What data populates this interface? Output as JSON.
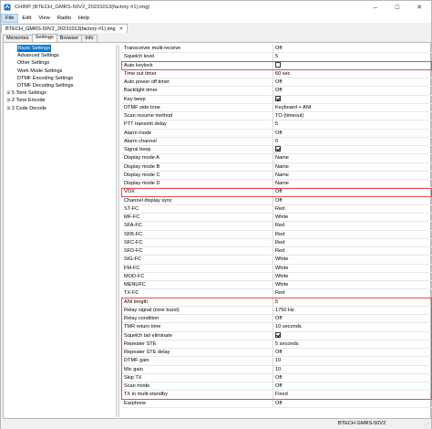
{
  "window": {
    "title": "CHIRP (BTECH_GMRS-50V2_20231013(factory #1).img)",
    "minimize": "–",
    "maximize": "☐",
    "close": "✕"
  },
  "menu": [
    {
      "label": "File"
    },
    {
      "label": "Edit"
    },
    {
      "label": "View"
    },
    {
      "label": "Radio"
    },
    {
      "label": "Help"
    }
  ],
  "doc_tab": {
    "label": "BTECH_GMRS-50V2_20231013(factory #1).img",
    "close": "✕"
  },
  "sub_tabs": [
    {
      "label": "Memories"
    },
    {
      "label": "Settings"
    },
    {
      "label": "Browser"
    },
    {
      "label": "Info"
    }
  ],
  "tree": [
    {
      "label": "Basic Settings",
      "selected": true,
      "expander": ""
    },
    {
      "label": "Advanced Settings",
      "expander": ""
    },
    {
      "label": "Other Settings",
      "expander": ""
    },
    {
      "label": "Work Mode Settings",
      "expander": ""
    },
    {
      "label": "DTMF Encoding Settings",
      "expander": ""
    },
    {
      "label": "DTMF Decoding Settings",
      "expander": ""
    },
    {
      "label": "5 Tone Settings",
      "expander": "⊞",
      "top": true
    },
    {
      "label": "2 Tone Encode",
      "expander": "⊞",
      "top": true
    },
    {
      "label": "2 Code Decode",
      "expander": "⊞",
      "top": true
    }
  ],
  "settings": [
    {
      "name": "Transceiver multi-receive",
      "value": "Off"
    },
    {
      "name": "Squelch level",
      "value": "5"
    },
    {
      "name": "Auto keylock",
      "value": "",
      "checkbox": "off"
    },
    {
      "name": "Time out timer",
      "value": "60 sec"
    },
    {
      "name": "Auto power off timer",
      "value": "Off"
    },
    {
      "name": "Backlight timer",
      "value": "Off"
    },
    {
      "name": "Key beep",
      "value": "",
      "checkbox": "on"
    },
    {
      "name": "DTMF side tone",
      "value": "Keyboard + ANI"
    },
    {
      "name": "Scan resume method",
      "value": "TO (timeout)"
    },
    {
      "name": "PTT transmit delay",
      "value": "5"
    },
    {
      "name": "Alarm mode",
      "value": "Off"
    },
    {
      "name": "Alarm channel",
      "value": "0"
    },
    {
      "name": "Signal beep",
      "value": "",
      "checkbox": "on"
    },
    {
      "name": "Display mode A",
      "value": "Name"
    },
    {
      "name": "Display mode B",
      "value": "Name"
    },
    {
      "name": "Display mode C",
      "value": "Name"
    },
    {
      "name": "Display mode D",
      "value": "Name"
    },
    {
      "name": "VOX",
      "value": "Off"
    },
    {
      "name": "Channel display sync",
      "value": "Off"
    },
    {
      "name": "ST-FC",
      "value": "Red"
    },
    {
      "name": "MF-FC",
      "value": "White"
    },
    {
      "name": "SFA-FC",
      "value": "Red"
    },
    {
      "name": "SFB-FC",
      "value": "Red"
    },
    {
      "name": "SFC-FC",
      "value": "Red"
    },
    {
      "name": "SFD-FC",
      "value": "Red"
    },
    {
      "name": "SIG-FC",
      "value": "White"
    },
    {
      "name": "FM-FC",
      "value": "White"
    },
    {
      "name": "MOD-FC",
      "value": "White"
    },
    {
      "name": "MENUFC",
      "value": "White"
    },
    {
      "name": "TX-FC",
      "value": "Red"
    },
    {
      "name": "ANI length",
      "value": "5"
    },
    {
      "name": "Relay signal (tone burst)",
      "value": "1750 Hz"
    },
    {
      "name": "Relay condition",
      "value": "Off"
    },
    {
      "name": "TMR return time",
      "value": "10 seconds"
    },
    {
      "name": "Squelch tail eliminate",
      "value": "",
      "checkbox": "on"
    },
    {
      "name": "Repeater STE",
      "value": "5 seconds"
    },
    {
      "name": "Repeater STE delay",
      "value": "Off"
    },
    {
      "name": "DTMF gain",
      "value": "10"
    },
    {
      "name": "Mic gain",
      "value": "10"
    },
    {
      "name": "Skip TX",
      "value": "Off"
    },
    {
      "name": "Scan mode",
      "value": "Off"
    },
    {
      "name": "TX in multi-standby",
      "value": "Fixed"
    },
    {
      "name": "Earphone",
      "value": "Off"
    }
  ],
  "highlight_color": "#e05050",
  "selection_color": "#0078d7",
  "status": {
    "text": "BTECH GMRS-50V2",
    "grip": "⋰"
  }
}
